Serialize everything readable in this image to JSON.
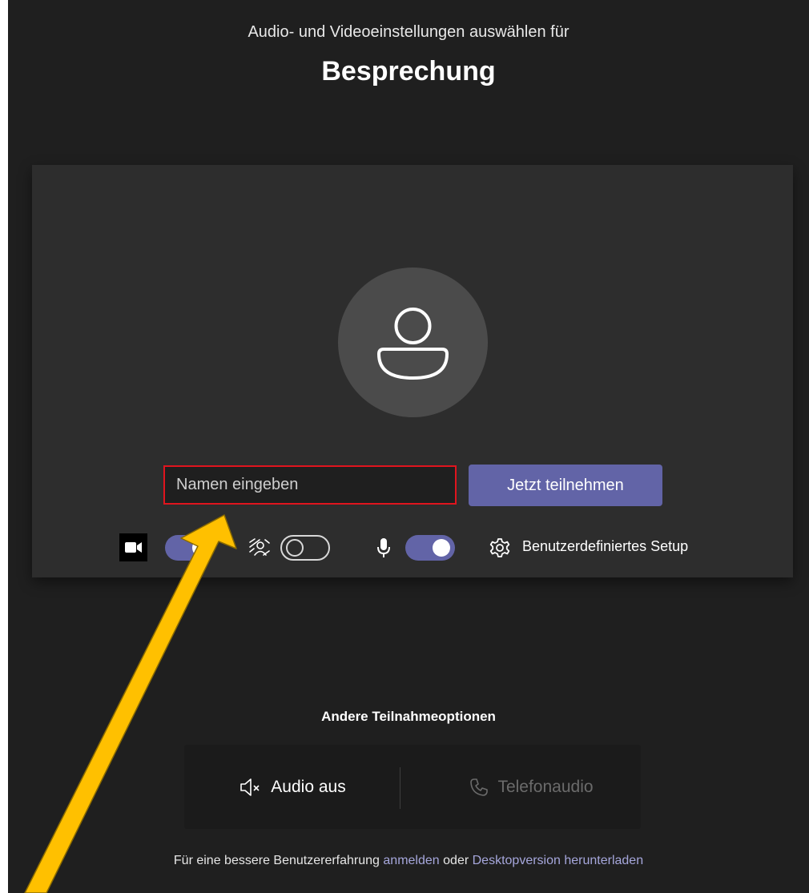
{
  "header": {
    "subtitle": "Audio- und Videoeinstellungen auswählen für",
    "title": "Besprechung"
  },
  "preview": {
    "avatar_icon": "person-icon",
    "name_input": {
      "value": "",
      "placeholder": "Namen eingeben"
    },
    "join_button_label": "Jetzt teilnehmen",
    "controls": {
      "camera_icon": "camera-icon",
      "camera_toggle_on": true,
      "background_icon": "background-blur-icon",
      "background_toggle_on": false,
      "microphone_icon": "microphone-icon",
      "microphone_toggle_on": true,
      "setup_icon": "gear-icon",
      "setup_label": "Benutzerdefiniertes Setup"
    }
  },
  "other_options": {
    "title": "Andere Teilnahmeoptionen",
    "audio_off_icon": "speaker-muted-icon",
    "audio_off_label": "Audio aus",
    "phone_icon": "phone-icon",
    "phone_label": "Telefonaudio"
  },
  "footer": {
    "prefix": "Für eine bessere Benutzererfahrung",
    "signin_link": "anmelden",
    "middle": "oder",
    "download_link": "Desktopversion herunterladen"
  },
  "colors": {
    "background": "#1f1f1f",
    "panel": "#2d2d2d",
    "accent": "#6264a7",
    "highlight_border": "#e0141e",
    "annotation_arrow": "#ffc000",
    "link": "#a6a7dc"
  },
  "annotation": {
    "arrow_icon": "annotation-arrow-icon"
  }
}
